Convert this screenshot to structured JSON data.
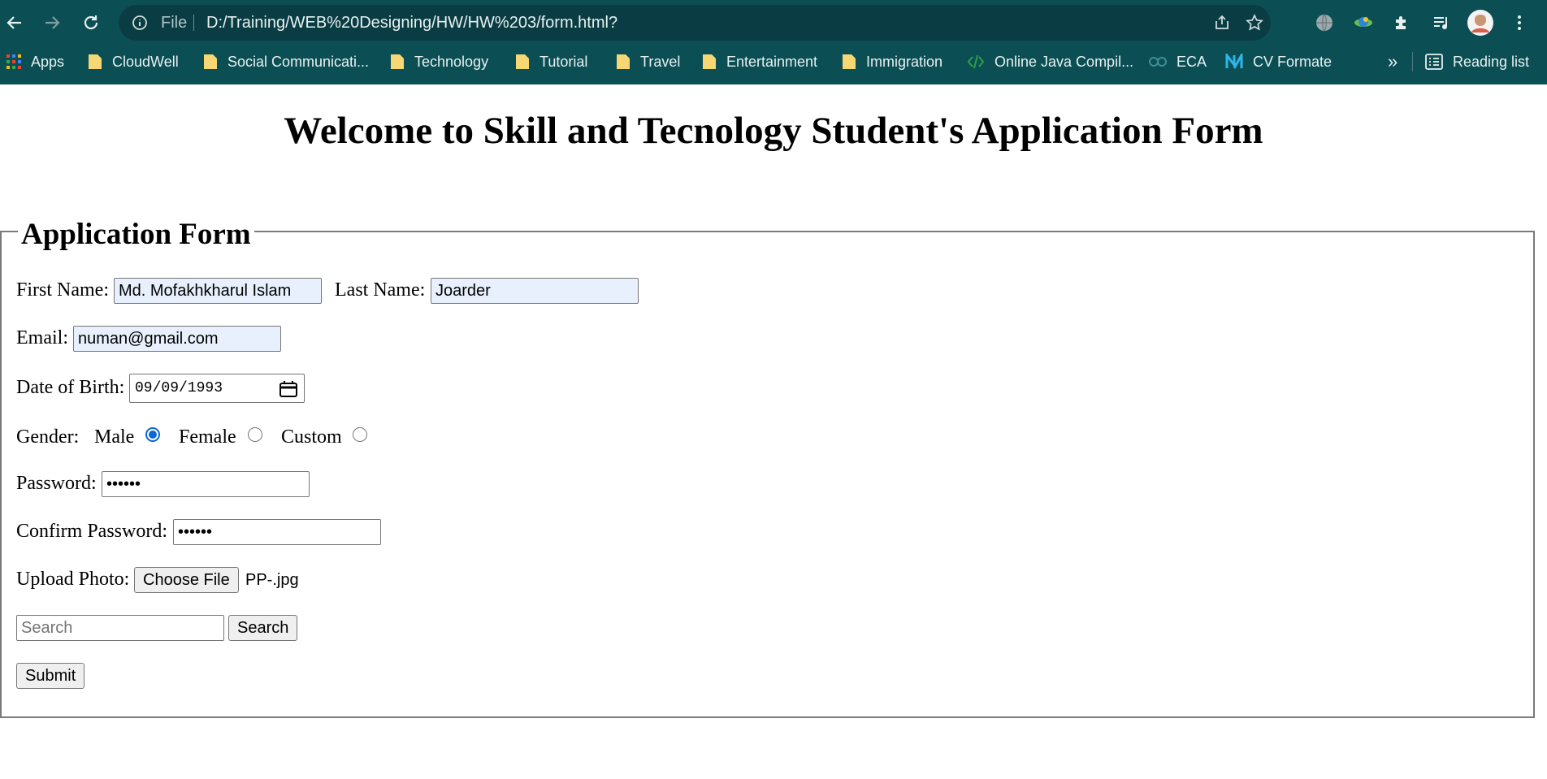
{
  "browser": {
    "url_prefix": "File",
    "url": "D:/Training/WEB%20Designing/HW/HW%203/form.html?",
    "bookmarks": [
      {
        "label": "Apps",
        "icon": "apps-grid-icon"
      },
      {
        "label": "CloudWell",
        "icon": "folder-icon"
      },
      {
        "label": "Social Communicati...",
        "icon": "folder-icon"
      },
      {
        "label": "Technology",
        "icon": "folder-icon"
      },
      {
        "label": "Tutorial",
        "icon": "folder-icon"
      },
      {
        "label": "Travel",
        "icon": "folder-icon"
      },
      {
        "label": "Entertainment",
        "icon": "folder-icon"
      },
      {
        "label": "Immigration",
        "icon": "folder-icon"
      },
      {
        "label": "Online Java Compil...",
        "icon": "code-icon"
      },
      {
        "label": "ECA",
        "icon": "link-icon"
      },
      {
        "label": "CV Formate",
        "icon": "n-logo-icon"
      }
    ],
    "overflow_label": "»",
    "reading_list_label": "Reading list"
  },
  "page": {
    "title": "Welcome to Skill and Tecnology Student's Application Form",
    "legend": "Application Form",
    "first_name_label": "First Name:",
    "first_name_value": "Md. Mofakhkharul Islam",
    "last_name_label": "Last Name:",
    "last_name_value": "Joarder",
    "email_label": "Email:",
    "email_value": "numan@gmail.com",
    "dob_label": "Date of Birth:",
    "dob_value": "09/09/1993",
    "gender_label": "Gender:",
    "gender_options": [
      "Male",
      "Female",
      "Custom"
    ],
    "gender_selected": "Male",
    "password_label": "Password:",
    "password_value": "••••••",
    "confirm_password_label": "Confirm Password:",
    "confirm_password_value": "••••••",
    "upload_label": "Upload Photo:",
    "choose_file_label": "Choose File",
    "file_name": "PP-.jpg",
    "search_placeholder": "Search",
    "search_button": "Search",
    "submit_button": "Submit"
  },
  "colors": {
    "chrome_bg": "#0b4f55",
    "omnibox_bg": "#093d43",
    "radio_accent": "#0b66d6",
    "autofill_bg": "#e8f0fe"
  }
}
